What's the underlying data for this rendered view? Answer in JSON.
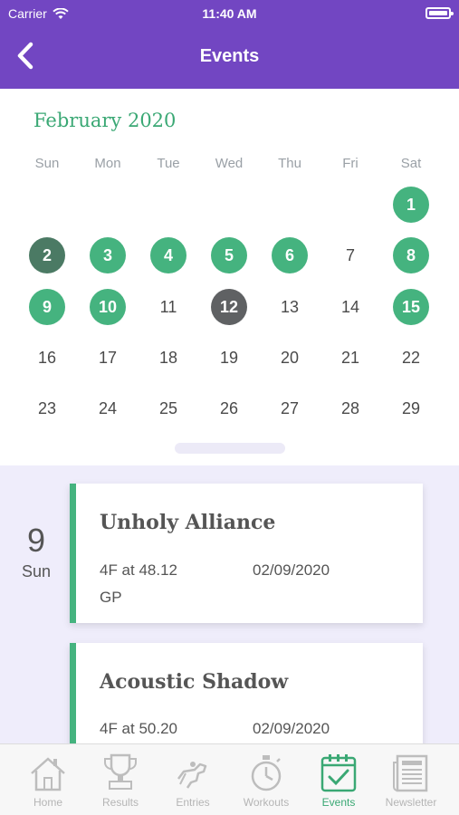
{
  "status_bar": {
    "carrier": "Carrier",
    "time": "11:40 AM"
  },
  "header": {
    "title": "Events",
    "back_icon": "chevron-left-icon"
  },
  "calendar": {
    "month_label": "February 2020",
    "weekdays": [
      "Sun",
      "Mon",
      "Tue",
      "Wed",
      "Thu",
      "Fri",
      "Sat"
    ],
    "days": [
      "1",
      "2",
      "3",
      "4",
      "5",
      "6",
      "7",
      "8",
      "9",
      "10",
      "11",
      "12",
      "13",
      "14",
      "15",
      "16",
      "17",
      "18",
      "19",
      "20",
      "21",
      "22",
      "23",
      "24",
      "25",
      "26",
      "27",
      "28",
      "29"
    ],
    "event_days": [
      "1",
      "3",
      "4",
      "5",
      "6",
      "8",
      "9",
      "10",
      "15"
    ],
    "selected_day": "2",
    "today": "12",
    "colors": {
      "event": "#45b37f",
      "selected": "#4b7a64",
      "today": "#5f6163",
      "accent": "#3aa874",
      "header": "#7246c2"
    }
  },
  "events": {
    "date_day": "9",
    "date_weekday": "Sun",
    "cards": [
      {
        "name": "Unholy Alliance",
        "workout": "4F at 48.12",
        "date": "02/09/2020",
        "track": "GP"
      },
      {
        "name": "Acoustic Shadow",
        "workout": "4F at 50.20",
        "date": "02/09/2020",
        "track": ""
      }
    ]
  },
  "tabbar": {
    "tabs": [
      {
        "label": "Home",
        "icon": "house-icon"
      },
      {
        "label": "Results",
        "icon": "trophy-icon"
      },
      {
        "label": "Entries",
        "icon": "racehorse-icon"
      },
      {
        "label": "Workouts",
        "icon": "stopwatch-icon"
      },
      {
        "label": "Events",
        "icon": "calendar-icon",
        "active": true
      },
      {
        "label": "Newsletter",
        "icon": "newspaper-icon"
      }
    ]
  }
}
